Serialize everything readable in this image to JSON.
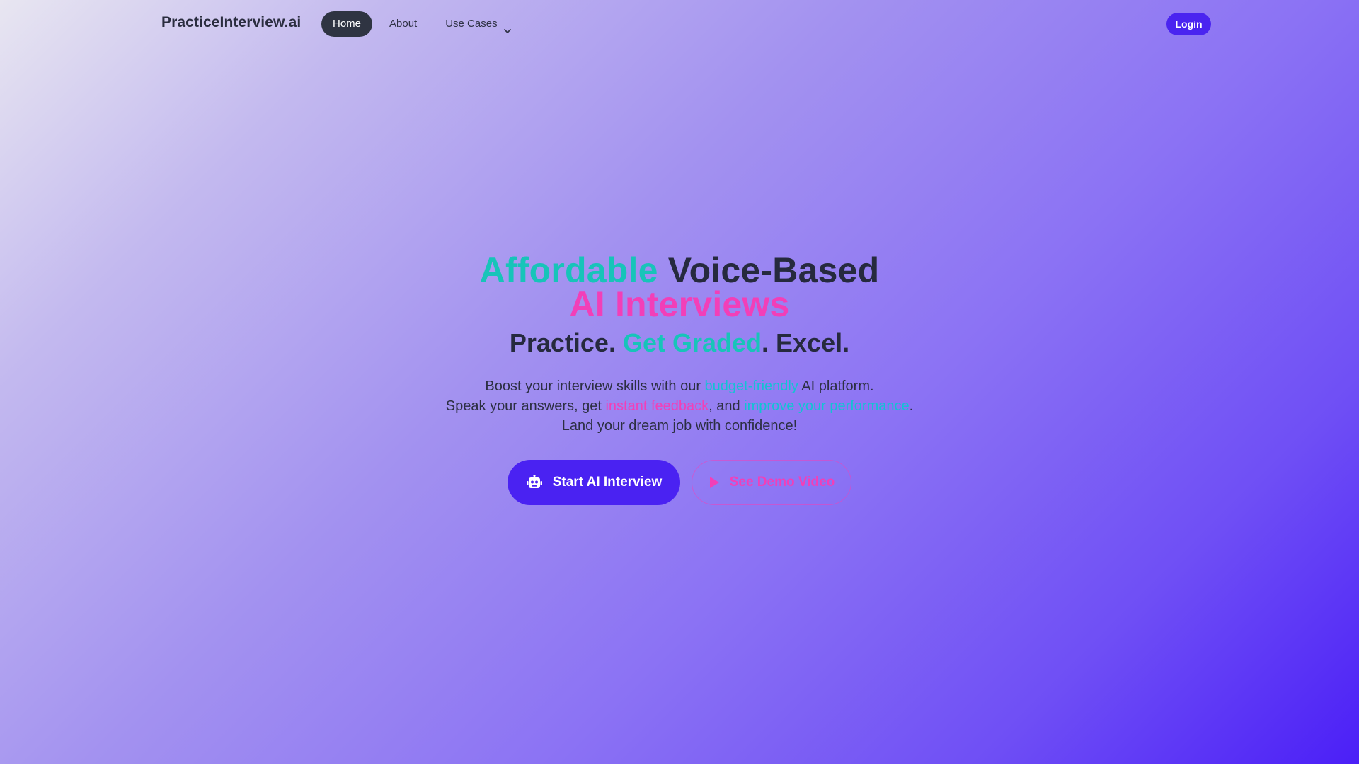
{
  "nav": {
    "brand": "PracticeInterview.ai",
    "items": [
      {
        "label": "Home"
      },
      {
        "label": "About"
      },
      {
        "label": "Use Cases"
      }
    ],
    "login_label": "Login"
  },
  "hero": {
    "title_line1_accent": "Affordable",
    "title_line1_rest": "Voice-Based",
    "title_line2": "AI Interviews",
    "subtitle_part1": "Practice. ",
    "subtitle_accent": "Get Graded",
    "subtitle_part2": ". Excel.",
    "desc_line1_pre": "Boost your interview skills with our ",
    "desc_line1_accent": "budget-friendly",
    "desc_line1_post": " AI platform.",
    "desc_line2_pre": "Speak your answers, get ",
    "desc_line2_accent1": "instant feedback",
    "desc_line2_mid": ", and ",
    "desc_line2_accent2": "improve your performance",
    "desc_line2_post": ".",
    "desc_line3": "Land your dream job with confidence!",
    "primary_button": "Start AI Interview",
    "secondary_button": "See Demo Video"
  },
  "icons": {
    "primary_button_icon": "robot-icon",
    "secondary_button_icon": "play-icon",
    "dropdown_icon": "chevron-down-icon"
  },
  "colors": {
    "accent_teal": "#17c4b9",
    "accent_pink": "#f23fb8",
    "accent_cyan": "#12c3d3",
    "primary": "#4a22f2",
    "nav_active": "#2f3442"
  }
}
